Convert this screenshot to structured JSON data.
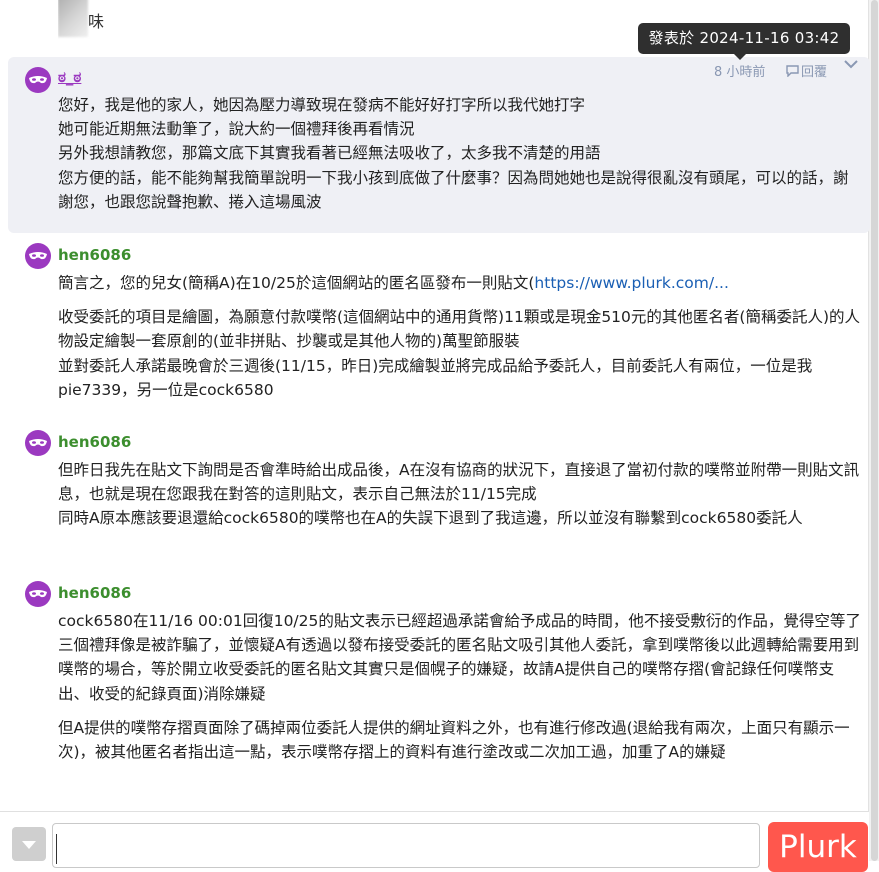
{
  "tooltip": {
    "text": "發表於 2024-11-16 03:42"
  },
  "top_thumbnail": {
    "text": "味"
  },
  "responses": [
    {
      "user": "ಠ_ಠ",
      "time": "8 小時前",
      "reply": "回覆",
      "lines": [
        "您好，我是他的家人，她因為壓力導致現在發病不能好好打字所以我代她打字",
        "她可能近期無法動筆了，說大約一個禮拜後再看情況",
        "另外我想請教您，那篇文底下其實我看著已經無法吸收了，太多我不清楚的用語",
        "您方便的話，能不能夠幫我簡單說明一下我小孩到底做了什麼事？因為問她她也是說得很亂沒有頭尾，可以的話，謝謝您，也跟您說聲抱歉、捲入這場風波"
      ]
    },
    {
      "user": "hen6086",
      "line1_prefix": "簡言之，您的兒女(簡稱A)在10/25於這個網站的匿名區發布一則貼文(",
      "line1_link": "https://www.plurk.com/...",
      "p2": "收受委託的項目是繪圖，為願意付款噗幣(這個網站中的通用貨幣)11顆或是現金510元的其他匿名者(簡稱委託人)的人物設定繪製一套原創的(並非拼貼、抄襲或是其他人物的)萬聖節服裝",
      "p3": "並對委託人承諾最晚會於三週後(11/15，昨日)完成繪製並將完成品給予委託人，目前委託人有兩位，一位是我pie7339，另一位是cock6580"
    },
    {
      "user": "hen6086",
      "p1": "但昨日我先在貼文下詢問是否會準時給出成品後，A在沒有協商的狀況下，直接退了當初付款的噗幣並附帶一則貼文訊息，也就是現在您跟我在對答的這則貼文，表示自己無法於11/15完成",
      "p2": "同時A原本應該要退還給cock6580的噗幣也在A的失誤下退到了我這邊，所以並沒有聯繫到cock6580委託人"
    },
    {
      "user": "hen6086",
      "p1": "cock6580在11/16 00:01回復10/25的貼文表示已經超過承諾會給予成品的時間，他不接受敷衍的作品，覺得空等了三個禮拜像是被詐騙了，並懷疑A有透過以發布接受委託的匿名貼文吸引其他人委託，拿到噗幣後以此週轉給需要用到噗幣的場合，等於開立收受委託的匿名貼文其實只是個幌子的嫌疑，故請A提供自己的噗幣存摺(會記錄任何噗幣支出、收受的紀錄頁面)消除嫌疑",
      "p2": "但A提供的噗幣存摺頁面除了碼掉兩位委託人提供的網址資料之外，也有進行修改過(退給我有兩次，上面只有顯示一次)，被其他匿名者指出這一點，表示噗幣存摺上的資料有進行塗改或二次加工過，加重了A的嫌疑"
    }
  ],
  "composer": {
    "button_label": "Plurk",
    "placeholder": ""
  },
  "colors": {
    "anon_mask": "#9b39c0",
    "user_green": "#3c8e2e",
    "highlight_bg": "#eff0f5",
    "plurk_button": "#ff574d"
  }
}
